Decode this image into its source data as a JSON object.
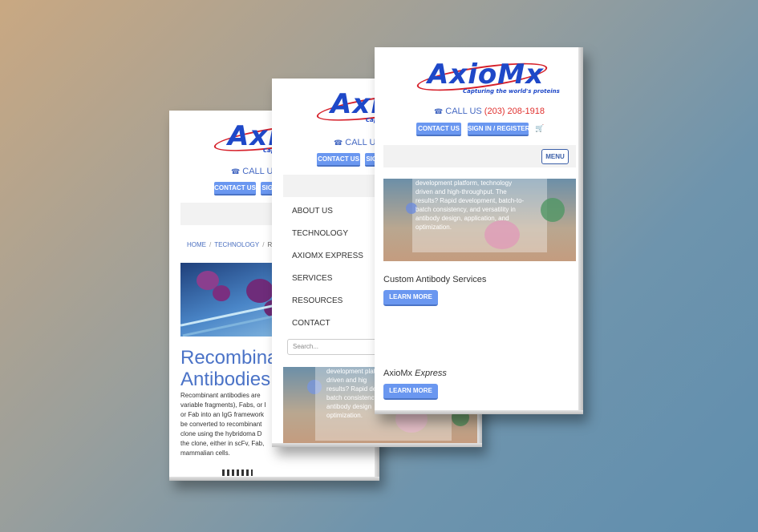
{
  "brand": {
    "logo_text": "AxioMx",
    "tagline": "Capturing the world's proteins"
  },
  "header": {
    "call_label": "CALL US",
    "phone_number": "(203) 208-1918",
    "contact_label": "CONTACT US",
    "signin_label": "SIGN IN / REGISTER",
    "menu_label": "MENU"
  },
  "icons": {
    "phone": "phone-icon",
    "cart": "cart-icon"
  },
  "colors": {
    "accent_blue": "#6a97f0",
    "phone_red": "#e0302e",
    "title_blue": "#4b73c7"
  },
  "left_screen": {
    "breadcrumb": {
      "home": "HOME",
      "technology": "TECHNOLOGY",
      "current": "RE"
    },
    "page_title_line1": "Recombinant",
    "page_title_line2": "Antibodies",
    "body_lines": [
      "Recombinant antibodies are",
      "variable fragments), Fabs, or I",
      "or Fab into an IgG framework",
      "be converted to recombinant",
      "clone using the hybridoma D",
      "the clone, either in scFv, Fab,",
      "mammalian cells."
    ]
  },
  "middle_screen": {
    "nav": [
      "ABOUT US",
      "TECHNOLOGY",
      "AXIOMX EXPRESS",
      "SERVICES",
      "RESOURCES",
      "CONTACT"
    ],
    "search_placeholder": "Search...",
    "hero_lines": [
      "development platf",
      "driven and hig",
      "results? Rapid dev",
      "batch consistency",
      "antibody design",
      "optimization."
    ]
  },
  "right_screen": {
    "hero_lines": [
      "development platform, technology",
      "driven and high-throughput. The",
      "results? Rapid development, batch-to-",
      "batch consistency, and versatility in",
      "antibody design, application, and",
      "optimization."
    ],
    "sections": [
      {
        "title": "Custom Antibody Services",
        "button": "LEARN MORE"
      },
      {
        "title_main": "AxioMx",
        "title_em": "Express",
        "button": "LEARN MORE"
      }
    ]
  }
}
